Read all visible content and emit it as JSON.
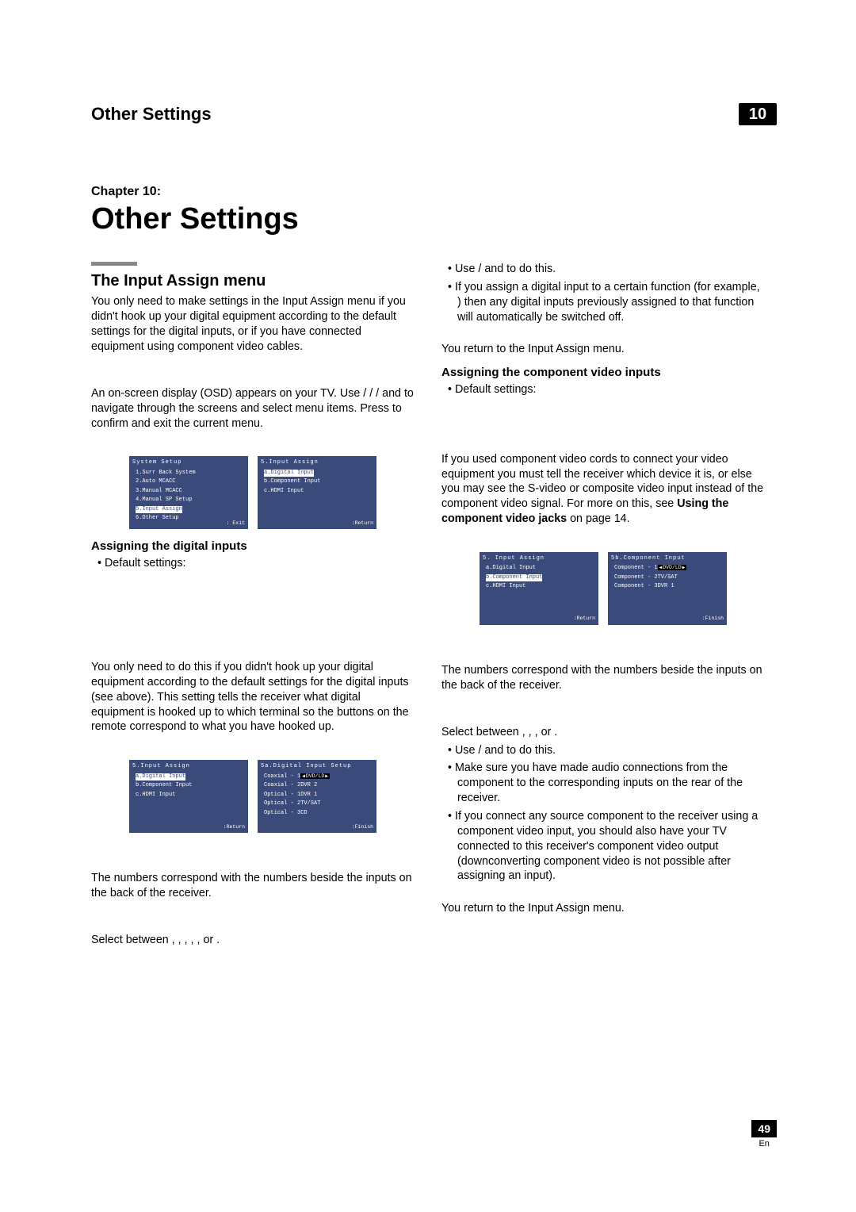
{
  "header": {
    "title": "Other Settings",
    "number": "10"
  },
  "chapter": {
    "label": "Chapter 10:",
    "title": "Other Settings"
  },
  "left": {
    "section_heading": "The Input Assign menu",
    "p1": "You only need to make settings in the Input Assign menu if you didn't hook up your digital equipment according to the default settings for the digital inputs, or if you have connected equipment using component video cables.",
    "p2": "An on-screen display (OSD) appears on your TV. Use  /   / /         and           to navigate through the screens and select menu items. Press              to confirm and exit the current menu.",
    "sub1": "Assigning the digital inputs",
    "bullet1": "Default settings:",
    "p3": "You only need to do this if you didn't hook up your digital equipment according to the default settings for the digital inputs (see above). This setting tells the receiver what digital equipment is hooked up to which terminal so the buttons on the remote correspond to what you have hooked up.",
    "p4": "The numbers correspond with the numbers beside the inputs on the back of the receiver.",
    "p5": "Select between         ,     ,       ,        ,           ,             or        .",
    "osd1": {
      "title": "System  Setup",
      "items": [
        "1.Surr  Back  System",
        "2.Auto  MCACC",
        "3.Manual  MCACC",
        "4.Manual  SP  Setup",
        "5.Input  Assign",
        "6.Other  Setup"
      ],
      "highlight": 4,
      "foot": ": Exit"
    },
    "osd2": {
      "title": "5.Input  Assign",
      "items": [
        "a.Digital  Input",
        "b.Component  Input",
        "c.HDMI Input"
      ],
      "highlight": 0,
      "foot": ":Return"
    },
    "osd3": {
      "title": "5.Input  Assign",
      "items": [
        "a.Digital  Input",
        "b.Component  Input",
        "c.HDMI Input"
      ],
      "highlight": 0,
      "foot": ":Return"
    },
    "osd4": {
      "title": "5a.Digital  Input  Setup",
      "rows": [
        {
          "l": "Coaxial - 1",
          "r": "DVD/LD",
          "sel": true
        },
        {
          "l": "Coaxial - 2",
          "r": "DVR 2"
        },
        {
          "l": "Optical - 1",
          "r": "DVR 1"
        },
        {
          "l": "Optical - 2",
          "r": "TV/SAT"
        },
        {
          "l": "Optical - 3",
          "r": "CD"
        }
      ],
      "foot": ":Finish"
    }
  },
  "right": {
    "b1": "Use    /       and            to do this.",
    "b2": "If you assign a digital input to a certain function (for example,             ) then any digital inputs previously assigned to that function will automatically be switched off.",
    "p1": "You return to the Input Assign menu.",
    "sub1": "Assigning the component video inputs",
    "bullet1": "Default settings:",
    "p2a": "If you used component video cords to connect your video equipment you must tell the receiver which device it is, or else you may see the S-video or composite video input instead of the component video signal. For more on this, see ",
    "p2b": "Using the component video jacks",
    "p2c": " on page 14.",
    "p3": "The numbers correspond with the numbers beside the inputs on the back of the receiver.",
    "p4": "Select between        ,     ,          ,            or       .",
    "b3": "Use    /       and            to do this.",
    "b4": "Make sure you have made audio connections from the component to the corresponding inputs on the rear of the receiver.",
    "b5": "If you connect any source component to the receiver using a component video input, you should also have your TV connected to this receiver's component video              output (downconverting component video is not possible after assigning an input).",
    "p5": "You return to the Input Assign menu.",
    "osd1": {
      "title": "5. Input  Assign",
      "items": [
        "a.Digital  Input",
        "b.Component  Input",
        "c.HDMI Input"
      ],
      "highlight": 1,
      "foot": ":Return"
    },
    "osd2": {
      "title": "5b.Component  Input",
      "rows": [
        {
          "l": "Component - 1",
          "r": "DVD/LD",
          "sel": true
        },
        {
          "l": "Component - 2",
          "r": "TV/SAT"
        },
        {
          "l": "Component - 3",
          "r": "DVR 1"
        }
      ],
      "foot": ":Finish"
    }
  },
  "footer": {
    "page": "49",
    "lang": "En"
  }
}
